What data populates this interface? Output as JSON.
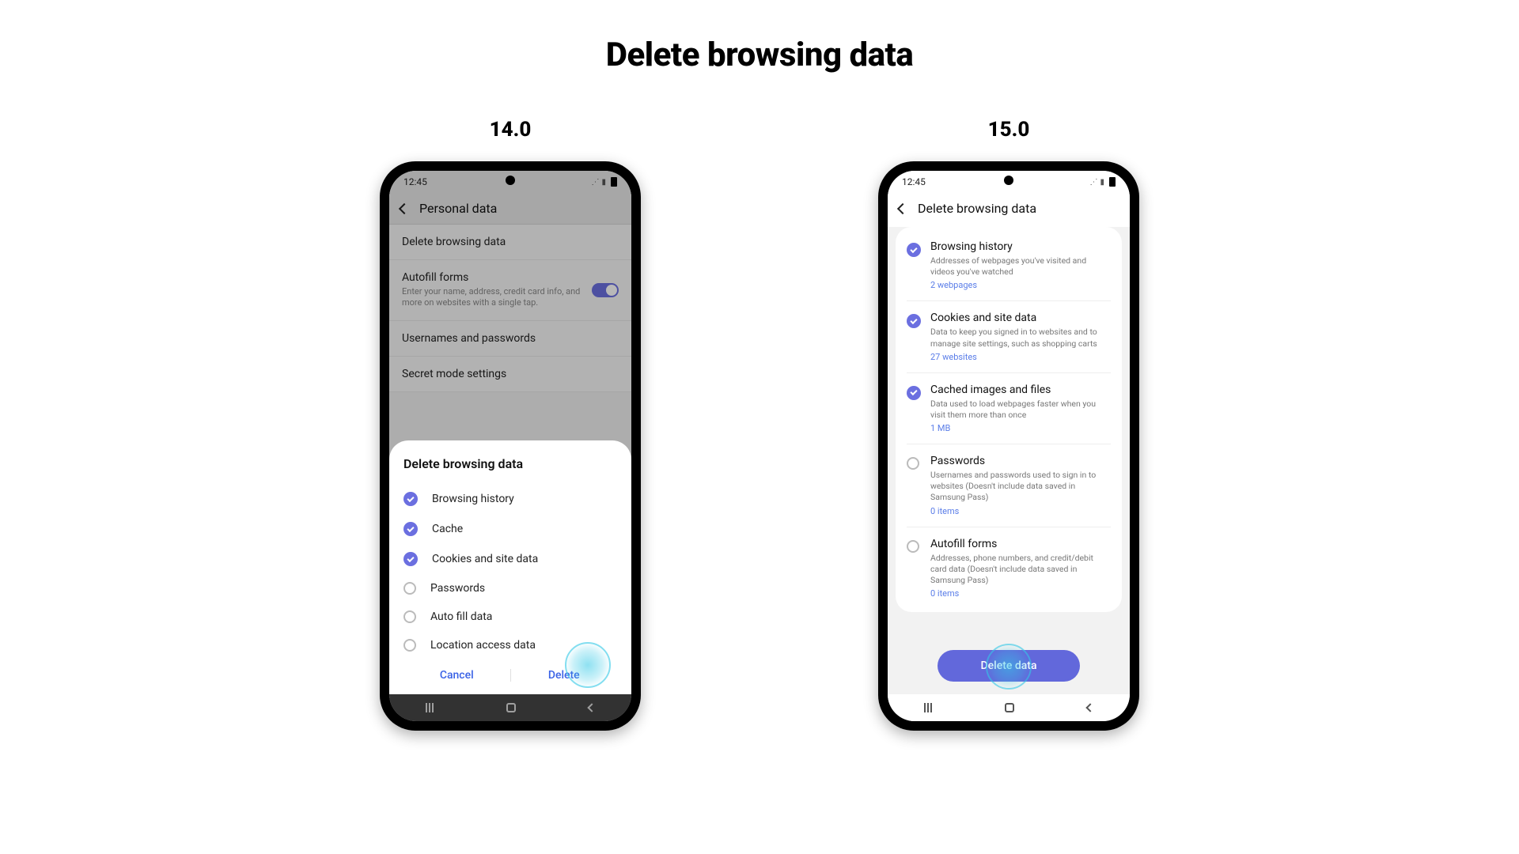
{
  "page": {
    "title": "Delete browsing data"
  },
  "versions": {
    "left": "14.0",
    "right": "15.0"
  },
  "status": {
    "time": "12:45"
  },
  "phoneA": {
    "header": "Personal data",
    "bg_items": [
      {
        "title": "Delete browsing data",
        "sub": "",
        "toggle": false
      },
      {
        "title": "Autofill forms",
        "sub": "Enter your name, address, credit card info, and more on websites with a single tap.",
        "toggle": true
      },
      {
        "title": "Usernames and passwords",
        "sub": "",
        "toggle": false
      },
      {
        "title": "Secret mode settings",
        "sub": "",
        "toggle": false
      }
    ],
    "sheet": {
      "title": "Delete browsing data",
      "options": [
        {
          "label": "Browsing history",
          "checked": true
        },
        {
          "label": "Cache",
          "checked": true
        },
        {
          "label": "Cookies and site data",
          "checked": true
        },
        {
          "label": "Passwords",
          "checked": false
        },
        {
          "label": "Auto fill data",
          "checked": false
        },
        {
          "label": "Location access data",
          "checked": false
        }
      ],
      "cancel": "Cancel",
      "confirm": "Delete"
    }
  },
  "phoneB": {
    "header": "Delete browsing data",
    "rows": [
      {
        "title": "Browsing history",
        "desc": "Addresses of webpages you've visited and videos you've watched",
        "meta": "2 webpages",
        "checked": true
      },
      {
        "title": "Cookies and site data",
        "desc": "Data to keep you signed in to websites and to manage site settings, such as shopping carts",
        "meta": "27 websites",
        "checked": true
      },
      {
        "title": "Cached images and files",
        "desc": "Data used to load webpages faster when you visit them more than once",
        "meta": "1 MB",
        "checked": true
      },
      {
        "title": "Passwords",
        "desc": "Usernames and passwords used to sign in to websites (Doesn't include data saved in Samsung Pass)",
        "meta": "0 items",
        "checked": false
      },
      {
        "title": "Autofill forms",
        "desc": "Addresses, phone numbers, and credit/debit card data (Doesn't include data saved in Samsung Pass)",
        "meta": "0 items",
        "checked": false
      }
    ],
    "primary": "Delete data"
  }
}
